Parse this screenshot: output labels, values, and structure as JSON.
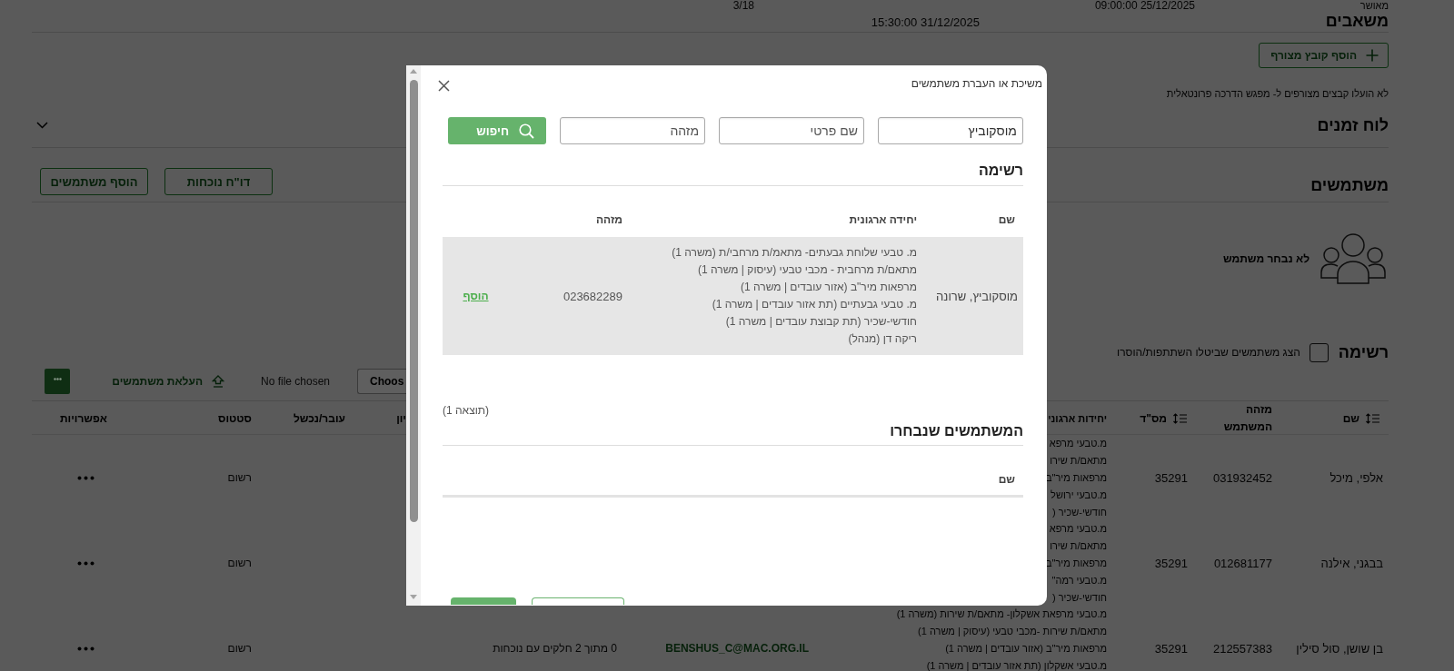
{
  "info_row": {
    "column_1": "מאושר",
    "column_2": "09:00:00 25/12/2025",
    "column_3": "15:30:00 31/12/2025",
    "column_4": "3/18"
  },
  "resources": {
    "title": "משאבים",
    "add_button": "הוסף קובץ מצורף",
    "empty_message": "לא הועלו קבצים מצורפים ל- מפגש הדרכה פרונטאלית"
  },
  "schedule": {
    "title": "לוח זמנים",
    "expanded": false
  },
  "users": {
    "title": "משתמשים",
    "buttons": [
      "דו\"ח נוכחות",
      "הוסף משתמשים"
    ],
    "empty_state": "לא נבחר משתמש"
  },
  "list": {
    "title": "רשימה",
    "show_removed": {
      "label": "הצג משתמשים שביטלו השתתפות/הוסרו",
      "checked": false
    },
    "file_input": {
      "button": "Choos",
      "status": "No file chosen"
    },
    "upload_link": "העלאת משתמשים",
    "columns": [
      {
        "label": "שם",
        "sortable": true
      },
      {
        "label": "מזהה המשתמש",
        "sortable": false
      },
      {
        "label": "מס\"ד",
        "sortable": true
      },
      {
        "label": "יחידות ארגוני",
        "sortable": false
      },
      {
        "label": "יון",
        "sortable": false
      },
      {
        "label": "עובר/נכשל",
        "sortable": false
      },
      {
        "label": "סטטוס",
        "sortable": false
      },
      {
        "label": "אפשרויות",
        "sortable": false
      }
    ],
    "rows": [
      {
        "name": "אלפי, מיכל",
        "user_id": "031932452",
        "serial": "35291",
        "org_units": [
          "מ.טבעי מרפא",
          "מתאם/ת שירו",
          "מרפאות מיר\"ב",
          "מ.טבעי ירושל",
          "חודשי-שכיר ("
        ],
        "status": "רשום"
      },
      {
        "name": "בבגני, אילנה",
        "user_id": "012681177",
        "serial": "35291",
        "org_units": [
          "מ.טבעי מרפא",
          "מתאם/ת שירו",
          "מרפאות מיר\"ב",
          "מ.טבעי רמה\"",
          "חודשי-שכיר ("
        ],
        "status": "רשום"
      },
      {
        "name": "בן שושן, סול סילין",
        "user_id": "212557383",
        "serial": "35291",
        "org_units": [
          "מ.טבעי מרפאת אשקלון- מתאם/ת שירות (משרה 1)",
          "מתאם/ת שירות -מכבי טבעי (עיסוק | משרה 1)",
          "מרפאות מיר\"ב (אזור עובדים | משרה 1)",
          "מ.טבעי אשקלון (תת אזור עובדים | משרה 1)"
        ],
        "email": "BENSHUS_C@MAC.ORG.IL",
        "attendance": "0 מתוך 2 חלקים עם נוכחות",
        "status": "רשום"
      }
    ]
  },
  "dialog": {
    "title": "משיכת או העברת משתמשים",
    "search_fields": [
      {
        "value": "מוסקוביץ"
      },
      {
        "placeholder": "שם פרטי"
      },
      {
        "placeholder": "מזהה"
      }
    ],
    "search_button": "חיפוש",
    "results": {
      "title": "רשימה",
      "columns": [
        "שם",
        "יחידה ארגונית",
        "מזהה"
      ],
      "rows": [
        {
          "name": "מוסקוביץ, שרונה",
          "org_units": [
            "מ. טבעי שלוחת גבעתים- מתאמ/ת מרחבי/ת (משרה 1)",
            "מתאם/ת מרחבית - מכבי טבעי (עיסוק | משרה 1)",
            "מרפאות מיר\"ב (אזור עובדים | משרה 1)",
            "מ. טבעי גבעתיים (תת אזור עובדים | משרה 1)",
            "חודשי-שכיר (תת קבוצת עובדים | משרה 1)",
            "ריקה דן (מנהל)"
          ],
          "user_id": "023682289",
          "action": "הוסף"
        }
      ],
      "count": "(1 תוצאה)"
    },
    "selected": {
      "title": "המשתמשים שנבחרו",
      "columns": [
        "שם"
      ]
    }
  }
}
